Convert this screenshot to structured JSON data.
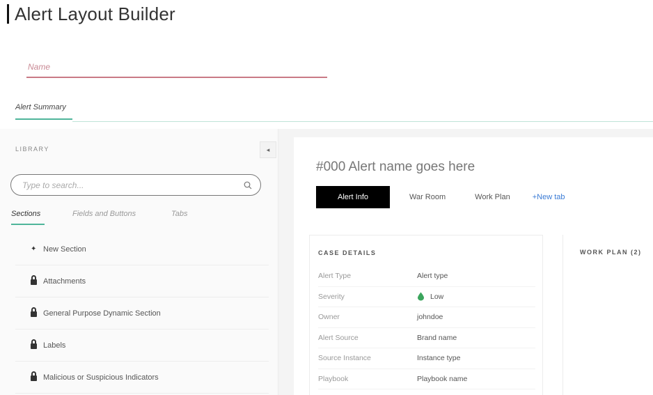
{
  "header": {
    "title": "Alert Layout Builder"
  },
  "name_field": {
    "placeholder": "Name"
  },
  "layout_tabs": [
    {
      "label": "Alert Summary",
      "active": true
    }
  ],
  "library": {
    "heading": "LIBRARY",
    "collapse_glyph": "◂",
    "search_placeholder": "Type to search...",
    "tabs": [
      {
        "label": "Sections",
        "active": true
      },
      {
        "label": "Fields and Buttons",
        "active": false
      },
      {
        "label": "Tabs",
        "active": false
      }
    ],
    "items": [
      {
        "label": "New Section",
        "icon": "plus-icon"
      },
      {
        "label": "Attachments",
        "icon": "lock-icon"
      },
      {
        "label": "General Purpose Dynamic Section",
        "icon": "lock-icon"
      },
      {
        "label": "Labels",
        "icon": "lock-icon"
      },
      {
        "label": "Malicious or Suspicious Indicators",
        "icon": "lock-icon"
      }
    ]
  },
  "alert": {
    "title": "#000  Alert name goes here",
    "tabs": [
      {
        "label": "Alert Info",
        "active": true
      },
      {
        "label": "War Room",
        "active": false
      },
      {
        "label": "Work Plan",
        "active": false
      }
    ],
    "new_tab_label": "+New tab",
    "case_details": {
      "heading": "CASE DETAILS",
      "rows": [
        {
          "label": "Alert Type",
          "value": "Alert type"
        },
        {
          "label": "Severity",
          "value": "Low",
          "icon": "severity-drop-icon"
        },
        {
          "label": "Owner",
          "value": "johndoe"
        },
        {
          "label": "Alert Source",
          "value": "Brand name"
        },
        {
          "label": "Source Instance",
          "value": "Instance type"
        },
        {
          "label": "Playbook",
          "value": "Playbook name"
        }
      ]
    },
    "work_plan": {
      "heading": "WORK PLAN (2)"
    }
  },
  "colors": {
    "accent": "#4fb59a",
    "name_underline": "#c97a86",
    "severity_low": "#3ba55d",
    "new_tab_link": "#3a7bd5"
  }
}
